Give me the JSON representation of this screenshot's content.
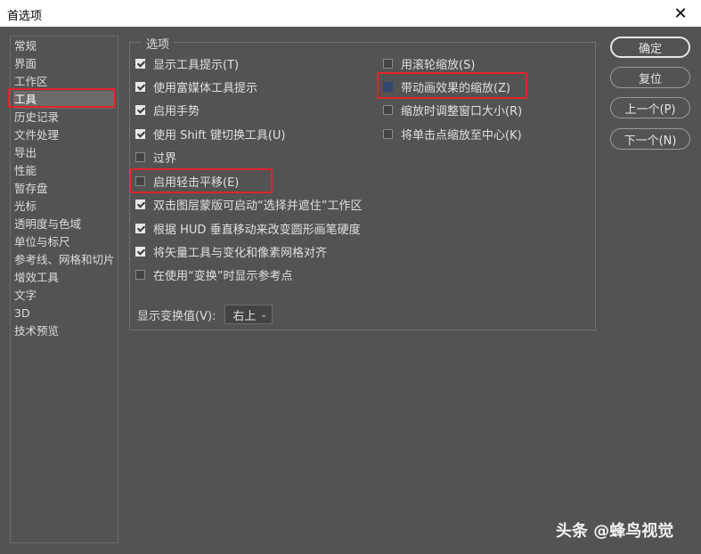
{
  "window": {
    "title": "首选项"
  },
  "sidebar": {
    "items": [
      {
        "label": "常规"
      },
      {
        "label": "界面"
      },
      {
        "label": "工作区"
      },
      {
        "label": "工具"
      },
      {
        "label": "历史记录"
      },
      {
        "label": "文件处理"
      },
      {
        "label": "导出"
      },
      {
        "label": "性能"
      },
      {
        "label": "暂存盘"
      },
      {
        "label": "光标"
      },
      {
        "label": "透明度与色域"
      },
      {
        "label": "单位与标尺"
      },
      {
        "label": "参考线、网格和切片"
      },
      {
        "label": "增效工具"
      },
      {
        "label": "文字"
      },
      {
        "label": "3D"
      },
      {
        "label": "技术预览"
      }
    ],
    "selected": "工具"
  },
  "options": {
    "group_title": "选项",
    "left": [
      {
        "label": "显示工具提示(T)",
        "checked": true
      },
      {
        "label": "使用富媒体工具提示",
        "checked": true
      },
      {
        "label": "启用手势",
        "checked": true
      },
      {
        "label": "使用 Shift 键切换工具(U)",
        "checked": true
      },
      {
        "label": "过界",
        "checked": false
      },
      {
        "label": "启用轻击平移(E)",
        "checked": false
      },
      {
        "label": "双击图层蒙版可启动“选择并遮住”工作区",
        "checked": true
      },
      {
        "label": "根据 HUD 垂直移动来改变圆形画笔硬度",
        "checked": true
      },
      {
        "label": "将矢量工具与变化和像素网格对齐",
        "checked": true
      },
      {
        "label": "在使用“变换”时显示参考点",
        "checked": false
      }
    ],
    "right": [
      {
        "label": "用滚轮缩放(S)",
        "checked": false
      },
      {
        "label": "带动画效果的缩放(Z)",
        "checked": false
      },
      {
        "label": "缩放时调整窗口大小(R)",
        "checked": false
      },
      {
        "label": "将单击点缩放至中心(K)",
        "checked": false
      }
    ],
    "transform_value": {
      "label": "显示变换值(V):",
      "value": "右上"
    }
  },
  "buttons": {
    "ok": "确定",
    "reset": "复位",
    "prev": "上一个(P)",
    "next": "下一个(N)"
  },
  "watermark": "头条 @蜂鸟视觉",
  "colors": {
    "highlight_box": "#e0242b",
    "background": "#535353"
  }
}
